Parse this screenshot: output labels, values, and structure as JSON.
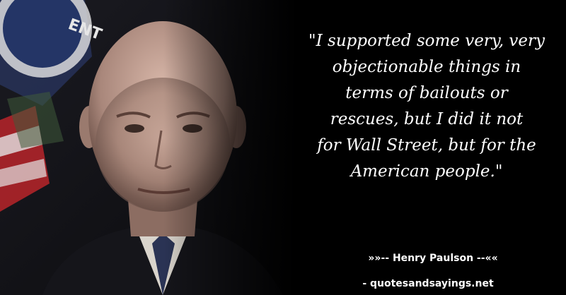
{
  "quote": {
    "lines": [
      "\"I supported some very, very",
      "objectionable things in",
      "terms of bailouts or",
      "rescues, but I did it not",
      "for Wall Street, but for the",
      "American people.\""
    ]
  },
  "attribution": {
    "text": "»»-- Henry Paulson --««"
  },
  "source": {
    "text": "- quotesandsayings.net"
  },
  "photo": {
    "subject": "portrait-photo"
  },
  "colors": {
    "background": "#000000",
    "text": "#ffffff"
  }
}
